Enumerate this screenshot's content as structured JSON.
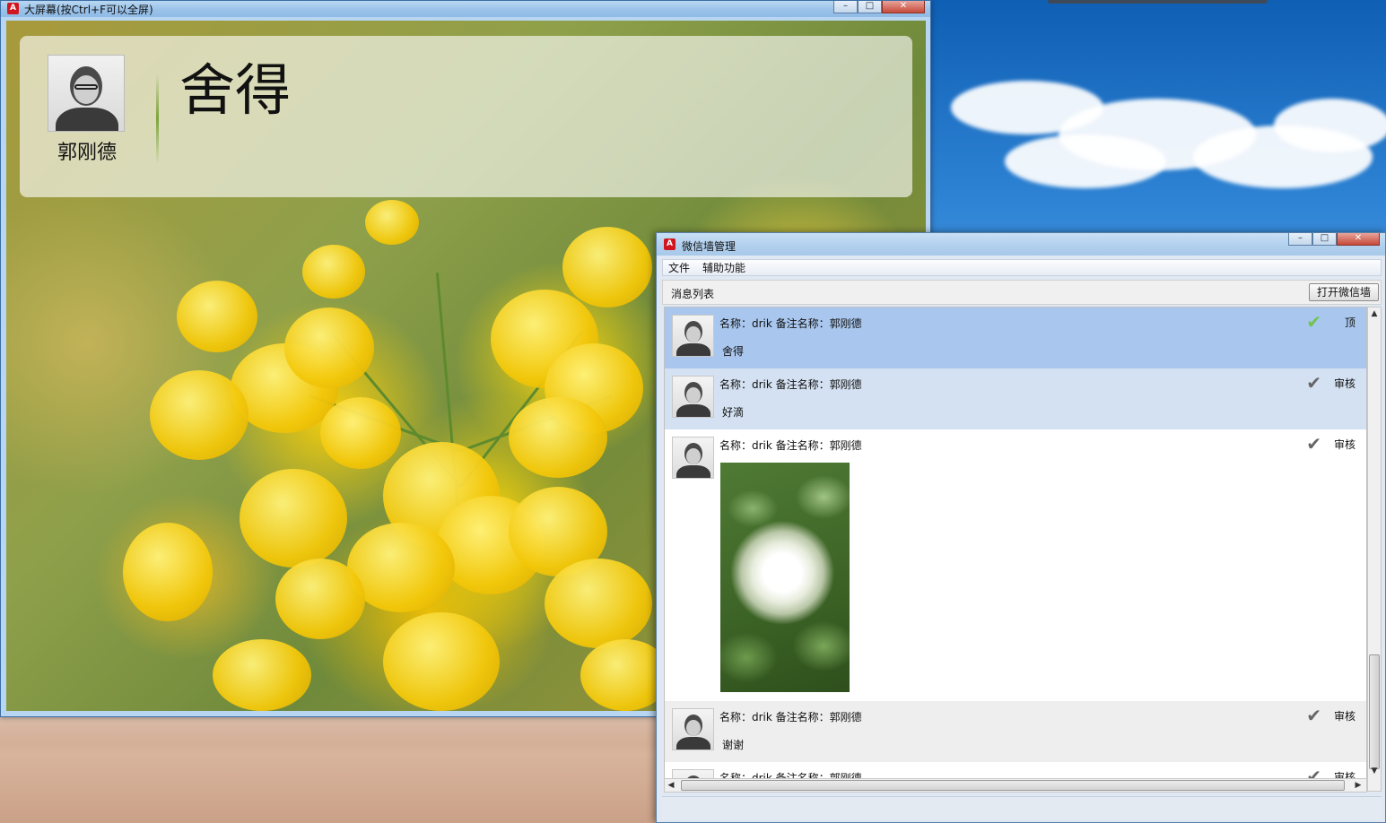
{
  "big_screen": {
    "window_title": "大屏幕(按Ctrl+F可以全屏)",
    "sender_name": "郭刚德",
    "message": "舍得"
  },
  "manager": {
    "window_title": "微信墙管理",
    "menu": [
      "文件",
      "辅助功能"
    ],
    "panel_label": "消息列表",
    "open_wall_button": "打开微信墙",
    "messages": [
      {
        "meta": "名称：drik    备注名称：郭刚德",
        "content": "舍得",
        "action": "顶",
        "approved": true
      },
      {
        "meta": "名称：drik    备注名称：郭刚德",
        "content": "好滴",
        "action": "审核",
        "approved": false
      },
      {
        "meta": "名称：drik    备注名称：郭刚德",
        "content": "",
        "action": "审核",
        "approved": false,
        "has_image": true
      },
      {
        "meta": "名称：drik    备注名称：郭刚德",
        "content": "谢谢",
        "action": "审核",
        "approved": false
      },
      {
        "meta": "名称：drik    备注名称：郭刚德",
        "content": "",
        "action": "审核",
        "approved": false
      }
    ]
  },
  "window_controls": {
    "minimize": "–",
    "maximize": "□",
    "close": "✕"
  },
  "icons": {
    "check": "✔",
    "app": "A"
  },
  "colors": {
    "selected_row": "#a9c7ee",
    "hover_row": "#d4e1f2",
    "approved_check": "#71c44f"
  }
}
